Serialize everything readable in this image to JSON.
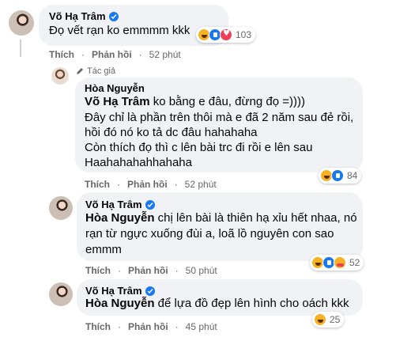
{
  "comments": [
    {
      "author": "Võ Hạ Trâm",
      "verified": true,
      "text": "Đọ vết rạn ko emmmm kkk",
      "reactions": [
        "haha",
        "like",
        "love"
      ],
      "reaction_count": "103",
      "actions": {
        "like": "Thích",
        "reply": "Phản hồi",
        "time": "52 phút"
      }
    },
    {
      "author_tag": "Tác giả",
      "author": "Hòa Nguyễn",
      "mention": "Võ Hạ Trâm",
      "lines": [
        " ko bằng e đâu, đừng đọ =))))",
        "Đây chỉ là phần trên thôi mà e đã 2 năm sau đẻ rồi,",
        "hồi đó nó ko tả dc đâu hahahaha",
        "Còn thích đọ thì c lên bài trc đi rồi e lên sau",
        "Haahahahahhahaha"
      ],
      "reactions": [
        "haha",
        "like"
      ],
      "reaction_count": "84",
      "actions": {
        "like": "Thích",
        "reply": "Phản hồi",
        "time": "52 phút"
      }
    },
    {
      "author": "Võ Hạ Trâm",
      "verified": true,
      "mention": "Hòa Nguyễn",
      "lines": [
        " chị lên bài là thiên hạ xỉu hết nhaa, nó",
        "rạn từ ngực xuống đùi a, loã lồ nguyên con sao",
        "emmm"
      ],
      "reactions": [
        "haha",
        "like",
        "care"
      ],
      "reaction_count": "52",
      "actions": {
        "like": "Thích",
        "reply": "Phản hồi",
        "time": "50 phút"
      }
    },
    {
      "author": "Võ Hạ Trâm",
      "verified": true,
      "mention": "Hòa Nguyễn",
      "lines": [
        " để lựa đồ đẹp lên hình cho oách kkk"
      ],
      "reactions": [
        "haha"
      ],
      "reaction_count": "25",
      "actions": {
        "like": "Thích",
        "reply": "Phản hồi",
        "time": "45 phút"
      }
    }
  ]
}
